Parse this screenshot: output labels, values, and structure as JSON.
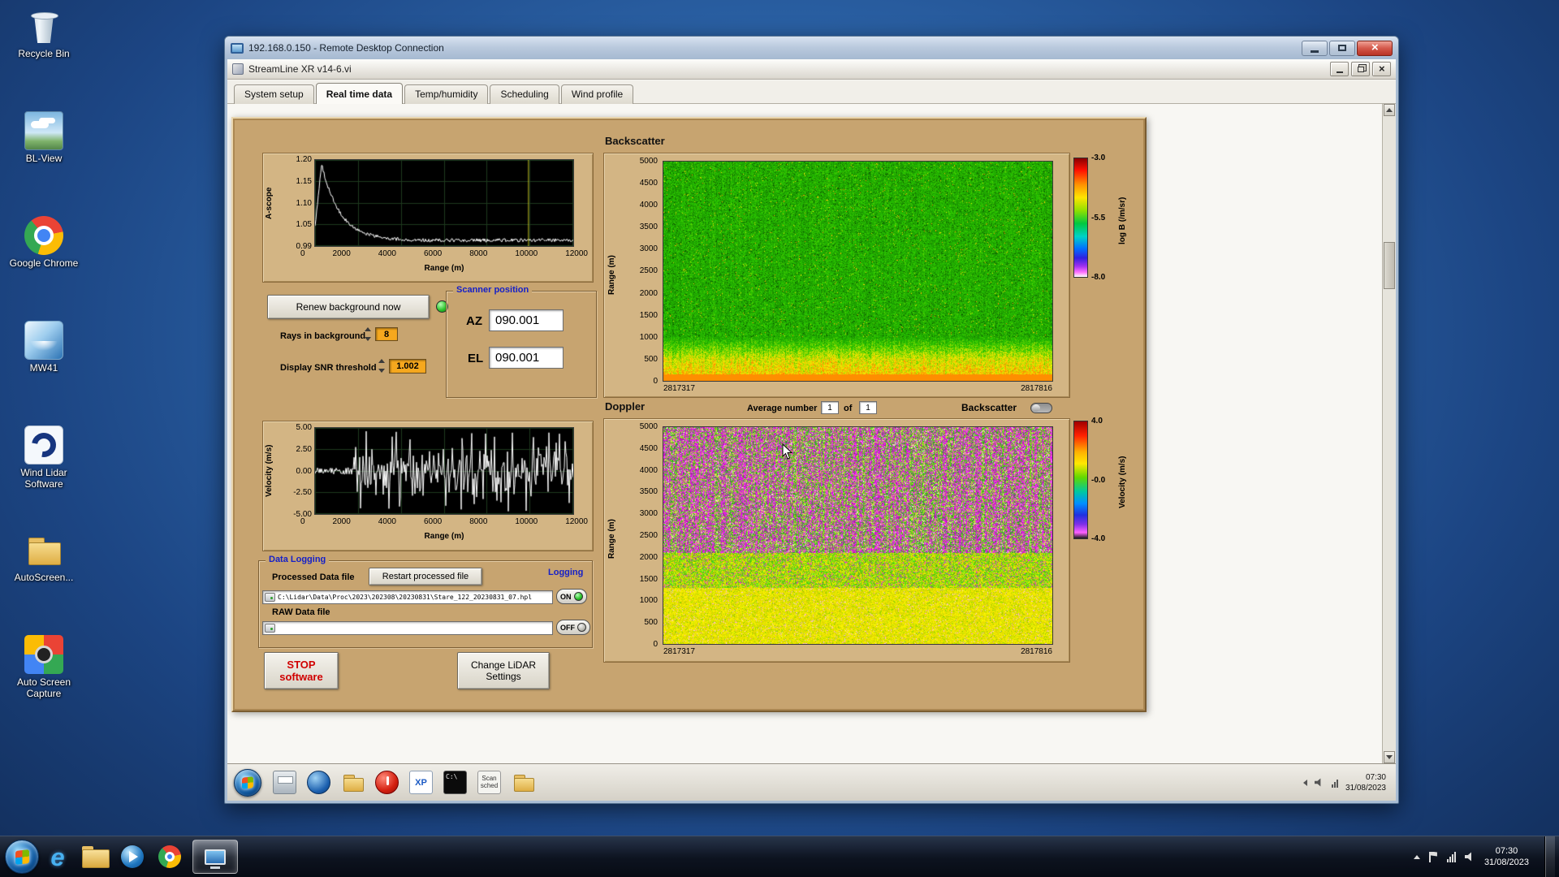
{
  "desktop": {
    "icons": [
      {
        "name": "recycle-bin",
        "label": "Recycle Bin"
      },
      {
        "name": "bl-view",
        "label": "BL-View"
      },
      {
        "name": "google-chrome",
        "label": "Google Chrome"
      },
      {
        "name": "mw41",
        "label": "MW41"
      },
      {
        "name": "wind-lidar-software",
        "label": "Wind Lidar Software"
      },
      {
        "name": "autoscreen",
        "label": "AutoScreen..."
      },
      {
        "name": "auto-screen-capture",
        "label": "Auto Screen Capture"
      }
    ]
  },
  "rdp_window": {
    "title": "192.168.0.150 - Remote Desktop Connection"
  },
  "app_window": {
    "title": "StreamLine XR v14-6.vi",
    "tabs": [
      {
        "label": "System setup",
        "active": false
      },
      {
        "label": "Real time data",
        "active": true
      },
      {
        "label": "Temp/humidity",
        "active": false
      },
      {
        "label": "Scheduling",
        "active": false
      },
      {
        "label": "Wind profile",
        "active": false
      }
    ]
  },
  "panel": {
    "renew_button": "Renew background now",
    "rays_label": "Rays in background",
    "rays_value": "8",
    "snr_label": "Display SNR threshold",
    "snr_value": "1.002",
    "scanner": {
      "title": "Scanner position",
      "az_label": "AZ",
      "az_value": "090.001",
      "el_label": "EL",
      "el_value": "090.001"
    },
    "average_label": "Average number",
    "average_value": "1",
    "average_of": "of",
    "average_total": "1",
    "backscatter_switch_label": "Backscatter",
    "logging": {
      "box_title": "Data Logging",
      "processed_label": "Processed Data file",
      "restart_button": "Restart processed file",
      "processed_path": "C:\\Lidar\\Data\\Proc\\2023\\202308\\20230831\\Stare_122_20230831_07.hpl",
      "logging_label": "Logging",
      "on_label": "ON",
      "off_label": "OFF",
      "raw_label": "RAW Data file",
      "raw_path": ""
    },
    "stop_button_line1": "STOP",
    "stop_button_line2": "software",
    "settings_button_line1": "Change LiDAR",
    "settings_button_line2": "Settings"
  },
  "remote_taskbar": {
    "quick_launch": [
      {
        "name": "printer",
        "text": ""
      },
      {
        "name": "app-blue",
        "text": ""
      },
      {
        "name": "folder-gold",
        "text": ""
      },
      {
        "name": "power-red",
        "text": ""
      },
      {
        "name": "xp-app",
        "text": "XP"
      },
      {
        "name": "cmd",
        "text": "C:\\"
      },
      {
        "name": "scan-sched",
        "text": "Scan sched"
      },
      {
        "name": "folder2",
        "text": ""
      }
    ],
    "clock_time": "07:30",
    "clock_date": "31/08/2023"
  },
  "host_taskbar": {
    "clock_time": "07:30",
    "clock_date": "31/08/2023"
  },
  "chart_data": [
    {
      "id": "a_scope",
      "type": "line",
      "ylabel": "A-scope",
      "xlabel": "Range (m)",
      "xlim": [
        0,
        12000
      ],
      "ylim": [
        0.99,
        1.2
      ],
      "xticks": [
        "0",
        "2000",
        "4000",
        "6000",
        "8000",
        "10000",
        "12000"
      ],
      "yticks": [
        "1.20",
        "1.15",
        "1.10",
        "1.05",
        "0.99"
      ],
      "series": [
        {
          "name": "background a-scope",
          "color": "#ffffff",
          "peak_x": 300,
          "peak_y": 1.2,
          "baseline": 1.0,
          "decay_to_x": 3000,
          "noise": 0.005
        }
      ],
      "event_marker_x": 9900,
      "plot_bg": "#000000",
      "grid_color": "#1e3a1e",
      "grid": true
    },
    {
      "id": "backscatter",
      "type": "heatmap",
      "title": "Backscatter",
      "ylabel": "Range (m)",
      "ylim": [
        0,
        5000
      ],
      "yticks": [
        "5000",
        "4500",
        "4000",
        "3500",
        "3000",
        "2500",
        "2000",
        "1500",
        "1000",
        "500",
        "0"
      ],
      "xticks": [
        "2817317",
        "2817816"
      ],
      "colorbar": {
        "label": "log B (/m/sr)",
        "ticks": [
          "-3.0",
          "-5.5",
          "-8.0"
        ],
        "range": [
          -3.0,
          -8.0
        ]
      },
      "bands": [
        {
          "range_m": [
            0,
            200
          ],
          "value": "saturated high backscatter (orange)"
        },
        {
          "range_m": [
            200,
            700
          ],
          "value": "strong aerosol layer (bright yellow)"
        },
        {
          "range_m": [
            700,
            1200
          ],
          "value": "yellow-green transition"
        },
        {
          "range_m": [
            1200,
            5000
          ],
          "value": "speckled green noise near -5.5"
        }
      ]
    },
    {
      "id": "velocity",
      "type": "line",
      "ylabel": "Velocity (m/s)",
      "xlabel": "Range (m)",
      "xlim": [
        0,
        12000
      ],
      "ylim": [
        -5,
        5
      ],
      "xticks": [
        "0",
        "2000",
        "4000",
        "6000",
        "8000",
        "10000",
        "12000"
      ],
      "yticks": [
        "5.00",
        "2.50",
        "0.00",
        "-2.50",
        "-5.00"
      ],
      "series": [
        {
          "name": "radial velocity",
          "color": "#ffffff",
          "quiet_range_m": [
            0,
            1800
          ],
          "noisy_range_m": [
            1800,
            12000
          ],
          "spike_amplitude": 5
        }
      ],
      "plot_bg": "#000000",
      "grid_color": "#1e3a1e",
      "grid": true
    },
    {
      "id": "doppler",
      "type": "heatmap",
      "title": "Doppler",
      "ylabel": "Range (m)",
      "ylim": [
        0,
        5000
      ],
      "yticks": [
        "5000",
        "4500",
        "4000",
        "3500",
        "3000",
        "2500",
        "2000",
        "1500",
        "1000",
        "500",
        "0"
      ],
      "xticks": [
        "2817317",
        "2817816"
      ],
      "colorbar": {
        "label": "Velocity (m/s)",
        "ticks": [
          "4.0",
          "-0.0",
          "-4.0"
        ],
        "range": [
          4.0,
          -4.0
        ]
      },
      "bands": [
        {
          "range_m": [
            0,
            1300
          ],
          "value": "coherent low-velocity returns (yellow-green)"
        },
        {
          "range_m": [
            1300,
            5000
          ],
          "value": "uncorrelated noise (magenta streaks over green)"
        }
      ]
    }
  ]
}
